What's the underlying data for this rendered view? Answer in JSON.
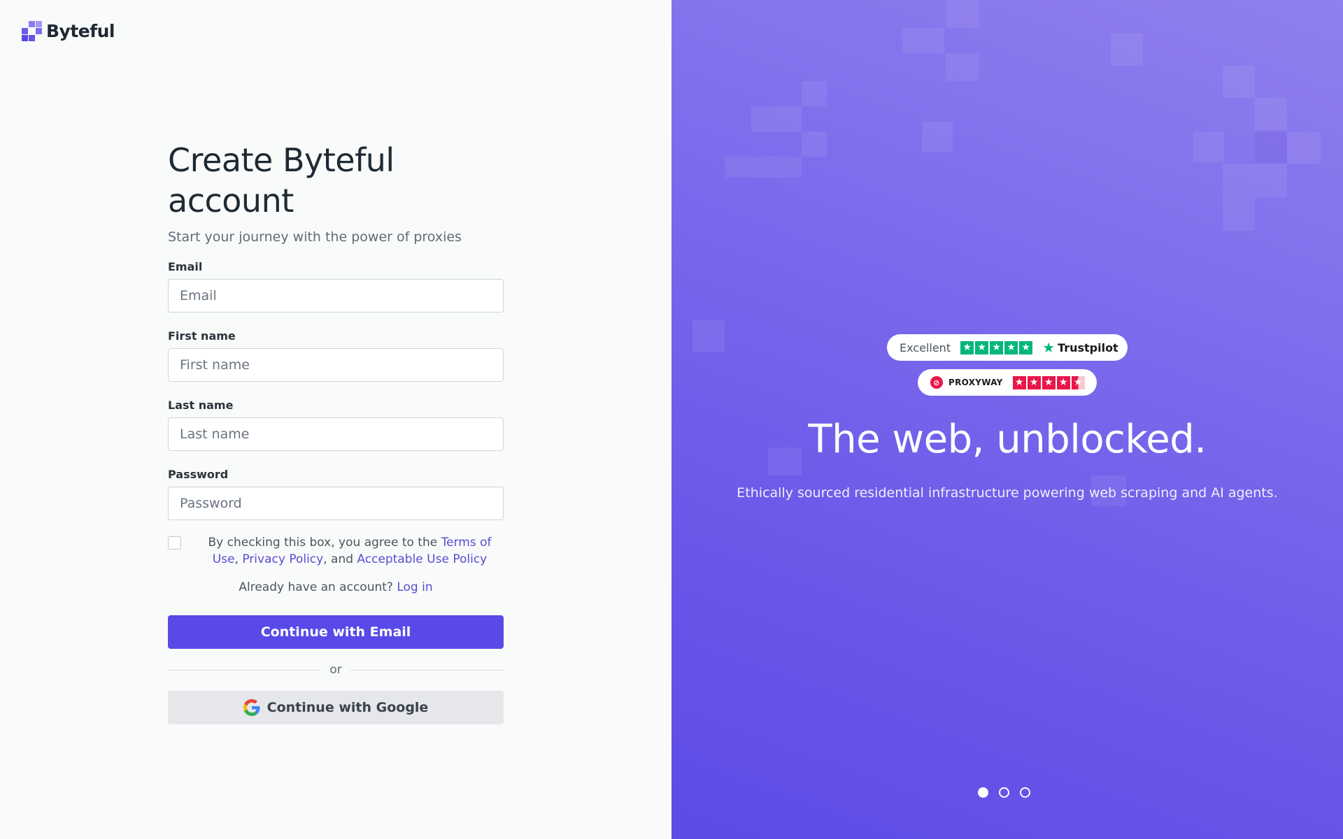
{
  "brand": {
    "name": "Byteful",
    "logo_icon": "byteful-pixel-logo-icon",
    "accent": "#6d5ce8"
  },
  "form": {
    "title": "Create Byteful account",
    "subtitle": "Start your journey with the power of proxies",
    "email": {
      "label": "Email",
      "placeholder": "Email",
      "value": ""
    },
    "first_name": {
      "label": "First name",
      "placeholder": "First name",
      "value": ""
    },
    "last_name": {
      "label": "Last name",
      "placeholder": "Last name",
      "value": ""
    },
    "password": {
      "label": "Password",
      "placeholder": "Password",
      "value": ""
    },
    "terms": {
      "checked": false,
      "prefix": "By checking this box, you agree to the ",
      "terms_link": "Terms of Use",
      "sep1": ",",
      "privacy_link": "Privacy Policy",
      "sep2": ", and ",
      "aup_link": "Acceptable Use Policy"
    },
    "login_prompt": "Already have an account?",
    "login_link": "Log in",
    "primary_button": "Continue with Email",
    "divider_text": "or",
    "google_button": "Continue with Google",
    "primary_color": "#5849e8"
  },
  "hero": {
    "trustpilot": {
      "label": "Excellent",
      "rating_stars": 5,
      "brand": "Trustpilot",
      "color": "#00b67a"
    },
    "proxyway": {
      "brand": "PROXYWAY",
      "rating_stars": 4.5,
      "color": "#e8174a"
    },
    "title": "The web, unblocked.",
    "subtitle": "Ethically sourced residential infrastructure powering web scraping and AI agents.",
    "carousel": {
      "count": 3,
      "active_index": 0
    }
  }
}
